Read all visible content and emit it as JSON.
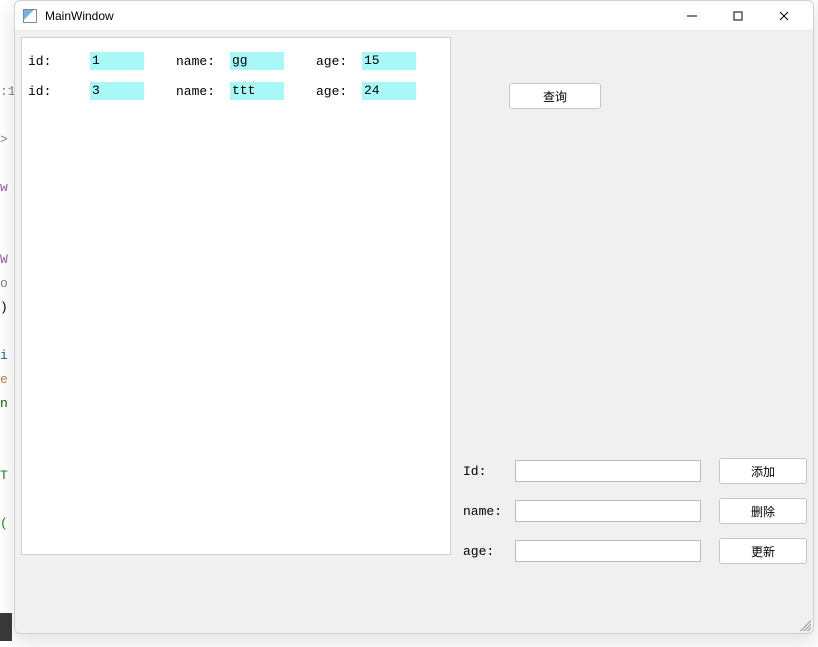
{
  "window": {
    "title": "MainWindow"
  },
  "list": {
    "labels": {
      "id": "id:",
      "name": "name:",
      "age": "age:"
    },
    "rows": [
      {
        "id": "1",
        "name": "gg",
        "age": "15"
      },
      {
        "id": "3",
        "name": "ttt",
        "age": "24"
      }
    ]
  },
  "buttons": {
    "query": "查询",
    "add": "添加",
    "delete": "删除",
    "update": "更新"
  },
  "form": {
    "id_label": "Id:",
    "name_label": "name:",
    "age_label": "age:",
    "id_value": "",
    "name_value": "",
    "age_value": ""
  },
  "gutter": [
    {
      "t": ":1",
      "c": "g-c1"
    },
    {
      "t": "",
      "c": "g-c4"
    },
    {
      "t": ">",
      "c": "g-c1"
    },
    {
      "t": "",
      "c": "g-c4"
    },
    {
      "t": "w",
      "c": "g-c3"
    },
    {
      "t": " ",
      "c": "g-c1"
    },
    {
      "t": "",
      "c": "g-c4"
    },
    {
      "t": "W",
      "c": "g-c3"
    },
    {
      "t": "o",
      "c": "g-c1"
    },
    {
      "t": ")",
      "c": "g-c4"
    },
    {
      "t": "",
      "c": "g-c4"
    },
    {
      "t": "i",
      "c": "g-c6"
    },
    {
      "t": "e",
      "c": "g-c2"
    },
    {
      "t": "n",
      "c": "g-c7"
    },
    {
      "t": "",
      "c": "g-c4"
    },
    {
      "t": "",
      "c": "g-c4"
    },
    {
      "t": "T",
      "c": "g-c5"
    },
    {
      "t": "",
      "c": "g-c4"
    },
    {
      "t": "(",
      "c": "g-c5"
    }
  ]
}
